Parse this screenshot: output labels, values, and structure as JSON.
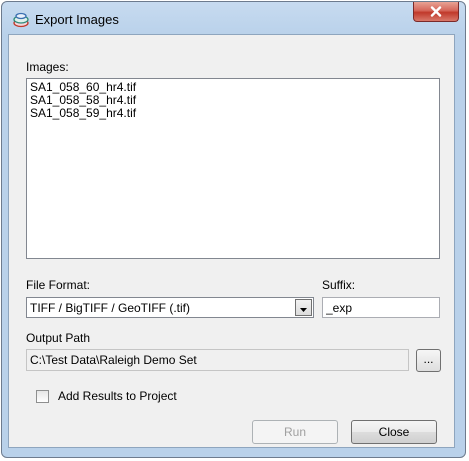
{
  "window": {
    "title": "Export Images",
    "app_icon": "stacked-layers-icon",
    "close_icon": "close-icon"
  },
  "images": {
    "label": "Images:",
    "items": [
      "SA1_058_60_hr4.tif",
      "SA1_058_58_hr4.tif",
      "SA1_058_59_hr4.tif"
    ]
  },
  "file_format": {
    "label": "File Format:",
    "selected": "TIFF / BigTIFF / GeoTIFF (.tif)"
  },
  "suffix": {
    "label": "Suffix:",
    "value": "_exp"
  },
  "output_path": {
    "label": "Output Path",
    "value": "C:\\Test Data\\Raleigh Demo Set",
    "browse_label": "..."
  },
  "add_results": {
    "label": "Add Results to Project",
    "checked": false
  },
  "buttons": {
    "run": "Run",
    "close": "Close"
  }
}
